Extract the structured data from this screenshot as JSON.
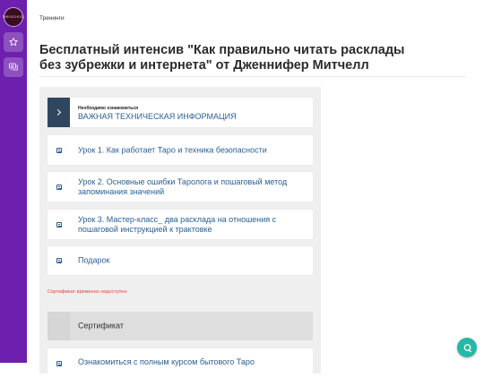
{
  "sidebar": {
    "logo_text": "TAROSCHOOL",
    "items": [
      {
        "icon": "star-icon"
      },
      {
        "icon": "chat-icon"
      }
    ]
  },
  "breadcrumb": "Тренинги",
  "page_title": "Бесплатный интенсив \"Как правильно читать расклады без зубрежки и интернета\" от Дженнифер Митчелл",
  "info_card": {
    "overline": "Необходимо ознакомиться",
    "label": "ВАЖНАЯ ТЕХНИЧЕСКАЯ ИНФОРМАЦИЯ"
  },
  "lessons": [
    {
      "label": "Урок 1. Как работает Таро и техника безопасности"
    },
    {
      "label": "Урок 2. Основные ошибки Таролога и пошаговый метод запоминания значений"
    },
    {
      "label": "Урок 3. Мастер-класс_ два расклада на отношения с пошаговой инструкцией к трактовке"
    },
    {
      "label": "Подарок"
    }
  ],
  "certificate_note": "Сертификат временно недоступен",
  "certificate_label": "Сертификат",
  "course_link_label": "Ознакомиться с полным курсом бытового Таро",
  "colors": {
    "sidebar": "#6d1fae",
    "link": "#2a5f95",
    "warning": "#e0453a",
    "chat_button": "#26b8a6"
  }
}
